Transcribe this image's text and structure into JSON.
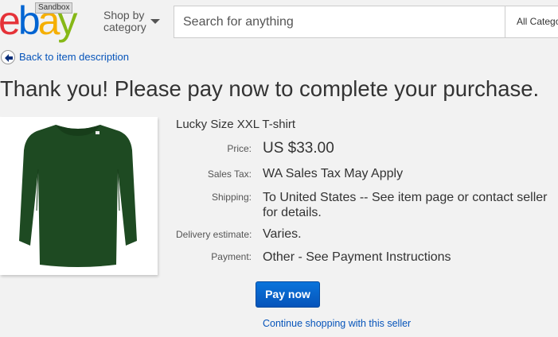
{
  "header": {
    "logo": "ebay",
    "sandbox_badge": "Sandbox",
    "shop_by_category": {
      "line1": "Shop by",
      "line2": "category"
    },
    "search": {
      "placeholder": "Search for anything",
      "category_selected": "All Catego"
    }
  },
  "back_link": {
    "label": "Back to item description",
    "icon": "back-arrow-icon"
  },
  "page_title": "Thank you! Please pay now to complete your purchase.",
  "item": {
    "title": "Lucky Size XXL T-shirt",
    "image_icon": "green-long-sleeve-shirt",
    "details": [
      {
        "label": "Price:",
        "value": "US $33.00"
      },
      {
        "label": "Sales Tax:",
        "value": "WA Sales Tax May Apply"
      },
      {
        "label": "Shipping:",
        "value": "To United States -- See item page or contact seller",
        "value_line2": "for details."
      },
      {
        "label": "Delivery estimate:",
        "value": "Varies."
      },
      {
        "label": "Payment:",
        "value": "Other - See Payment Instructions"
      }
    ]
  },
  "actions": {
    "pay_now": "Pay now",
    "continue_shopping": "Continue shopping with this seller"
  },
  "colors": {
    "link": "#0654ba",
    "button": "#0654ba",
    "shirt": "#1e4a22",
    "logo_e": "#e53238",
    "logo_b": "#0064d2",
    "logo_a": "#f5af02",
    "logo_y": "#86b817"
  }
}
